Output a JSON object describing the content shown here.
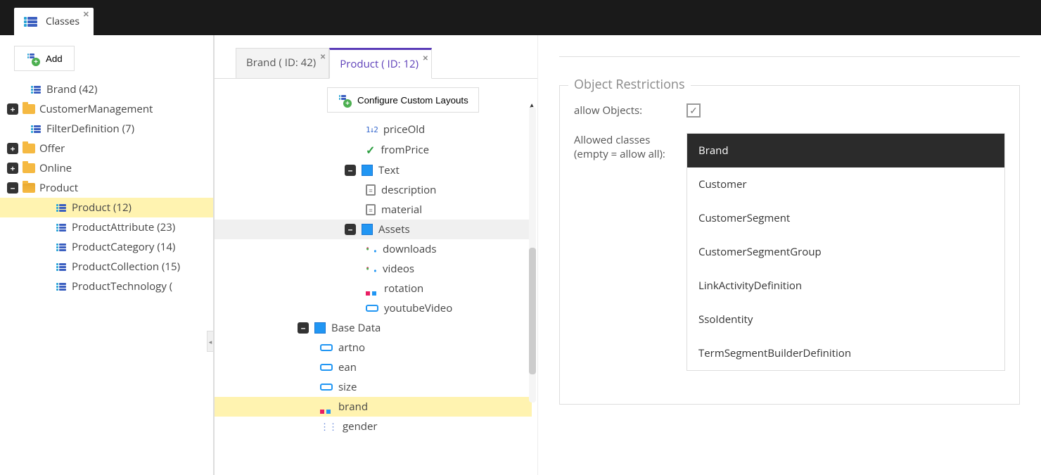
{
  "topTab": {
    "label": "Classes"
  },
  "addButton": {
    "label": "Add"
  },
  "sidebarTree": [
    {
      "label": "Brand (42)",
      "type": "class",
      "expander": "blank",
      "indent": 1
    },
    {
      "label": "CustomerManagement",
      "type": "folder",
      "expander": "plus",
      "indent": 0
    },
    {
      "label": "FilterDefinition (7)",
      "type": "class",
      "expander": "blank",
      "indent": 1
    },
    {
      "label": "Offer",
      "type": "folder",
      "expander": "plus",
      "indent": 0
    },
    {
      "label": "Online",
      "type": "folder",
      "expander": "plus",
      "indent": 0
    },
    {
      "label": "Product",
      "type": "folder-open",
      "expander": "minus",
      "indent": 0
    },
    {
      "label": "Product (12)",
      "type": "class",
      "expander": "blank",
      "indent": 2,
      "selected": true
    },
    {
      "label": "ProductAttribute (23)",
      "type": "class",
      "expander": "blank",
      "indent": 2
    },
    {
      "label": "ProductCategory (14)",
      "type": "class",
      "expander": "blank",
      "indent": 2
    },
    {
      "label": "ProductCollection (15)",
      "type": "class",
      "expander": "blank",
      "indent": 2
    },
    {
      "label": "ProductTechnology (",
      "type": "class",
      "expander": "blank",
      "indent": 2
    }
  ],
  "editorTabs": [
    {
      "label": "Brand ( ID: 42)",
      "active": false
    },
    {
      "label": "Product ( ID: 12)",
      "active": true
    }
  ],
  "configureButton": {
    "label": "Configure Custom Layouts"
  },
  "fieldTree": [
    {
      "label": "priceOld",
      "icon": "num",
      "depth": "2"
    },
    {
      "label": "fromPrice",
      "icon": "check",
      "depth": "2"
    },
    {
      "label": "Text",
      "icon": "panel",
      "depth": "1",
      "expander": "minus"
    },
    {
      "label": "description",
      "icon": "doc",
      "depth": "2"
    },
    {
      "label": "material",
      "icon": "doc",
      "depth": "2"
    },
    {
      "label": "Assets",
      "icon": "panel",
      "depth": "1",
      "expander": "minus",
      "hover": true
    },
    {
      "label": "downloads",
      "icon": "share",
      "depth": "2"
    },
    {
      "label": "videos",
      "icon": "share",
      "depth": "2"
    },
    {
      "label": "rotation",
      "icon": "rel",
      "depth": "2"
    },
    {
      "label": "youtubeVideo",
      "icon": "input",
      "depth": "2"
    },
    {
      "label": "Base Data",
      "icon": "panel",
      "depth": "bd0",
      "expander": "minus"
    },
    {
      "label": "artno",
      "icon": "input",
      "depth": "bd1"
    },
    {
      "label": "ean",
      "icon": "input",
      "depth": "bd1"
    },
    {
      "label": "size",
      "icon": "input",
      "depth": "bd1"
    },
    {
      "label": "brand",
      "icon": "rel",
      "depth": "bd1",
      "selected": true
    },
    {
      "label": "gender",
      "icon": "multisel",
      "depth": "bd1"
    }
  ],
  "rightPanel": {
    "legend": "Object Restrictions",
    "allowObjectsLabel": "allow Objects:",
    "allowObjectsChecked": true,
    "allowedClassesLabel": "Allowed classes (empty = allow all):",
    "classes": [
      {
        "name": "Brand",
        "selected": true
      },
      {
        "name": "Customer",
        "selected": false
      },
      {
        "name": "CustomerSegment",
        "selected": false
      },
      {
        "name": "CustomerSegmentGroup",
        "selected": false
      },
      {
        "name": "LinkActivityDefinition",
        "selected": false
      },
      {
        "name": "SsoIdentity",
        "selected": false
      },
      {
        "name": "TermSegmentBuilderDefinition",
        "selected": false
      }
    ]
  }
}
